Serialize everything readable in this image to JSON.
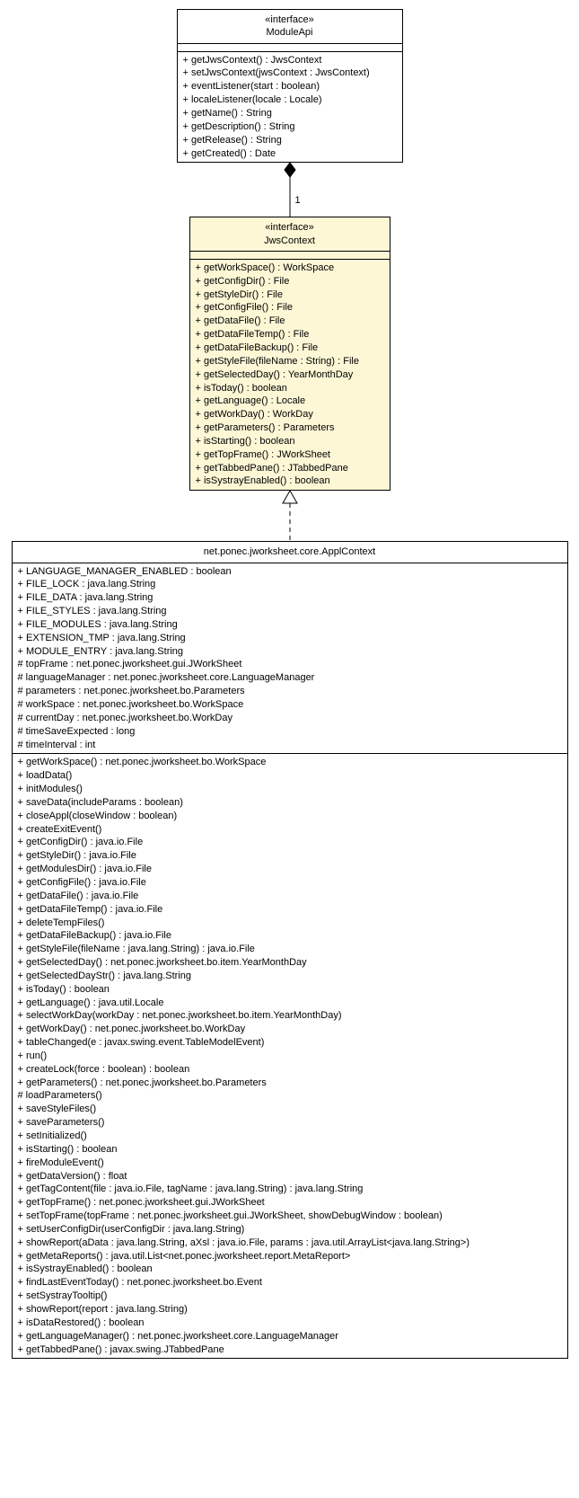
{
  "moduleApi": {
    "stereotype": "«interface»",
    "name": "ModuleApi",
    "ops": [
      "+ getJwsContext() : JwsContext",
      "+ setJwsContext(jwsContext : JwsContext)",
      "+ eventListener(start : boolean)",
      "+ localeListener(locale : Locale)",
      "+ getName() : String",
      "+ getDescription() : String",
      "+ getRelease() : String",
      "+ getCreated() : Date"
    ]
  },
  "multiplicity": "1",
  "jwsContext": {
    "stereotype": "«interface»",
    "name": "JwsContext",
    "ops": [
      "+ getWorkSpace() : WorkSpace",
      "+ getConfigDir() : File",
      "+ getStyleDir() : File",
      "+ getConfigFile() : File",
      "+ getDataFile() : File",
      "+ getDataFileTemp() : File",
      "+ getDataFileBackup() : File",
      "+ getStyleFile(fileName : String) : File",
      "+ getSelectedDay() : YearMonthDay",
      "+ isToday() : boolean",
      "+ getLanguage() : Locale",
      "+ getWorkDay() : WorkDay",
      "+ getParameters() : Parameters",
      "+ isStarting() : boolean",
      "+ getTopFrame() : JWorkSheet",
      "+ getTabbedPane() : JTabbedPane",
      "+ isSystrayEnabled() : boolean"
    ]
  },
  "applContext": {
    "name": "net.ponec.jworksheet.core.ApplContext",
    "attrs": [
      "+ LANGUAGE_MANAGER_ENABLED : boolean",
      "+ FILE_LOCK : java.lang.String",
      "+ FILE_DATA : java.lang.String",
      "+ FILE_STYLES : java.lang.String",
      "+ FILE_MODULES : java.lang.String",
      "+ EXTENSION_TMP : java.lang.String",
      "+ MODULE_ENTRY : java.lang.String",
      "# topFrame : net.ponec.jworksheet.gui.JWorkSheet",
      "# languageManager : net.ponec.jworksheet.core.LanguageManager",
      "# parameters : net.ponec.jworksheet.bo.Parameters",
      "# workSpace : net.ponec.jworksheet.bo.WorkSpace",
      "# currentDay : net.ponec.jworksheet.bo.WorkDay",
      "# timeSaveExpected : long",
      "# timeInterval : int"
    ],
    "ops": [
      "+ getWorkSpace() : net.ponec.jworksheet.bo.WorkSpace",
      "+ loadData()",
      "+ initModules()",
      "+ saveData(includeParams : boolean)",
      "+ closeAppl(closeWindow : boolean)",
      "+ createExitEvent()",
      "+ getConfigDir() : java.io.File",
      "+ getStyleDir() : java.io.File",
      "+ getModulesDir() : java.io.File",
      "+ getConfigFile() : java.io.File",
      "+ getDataFile() : java.io.File",
      "+ getDataFileTemp() : java.io.File",
      "+ deleteTempFiles()",
      "+ getDataFileBackup() : java.io.File",
      "+ getStyleFile(fileName : java.lang.String) : java.io.File",
      "+ getSelectedDay() : net.ponec.jworksheet.bo.item.YearMonthDay",
      "+ getSelectedDayStr() : java.lang.String",
      "+ isToday() : boolean",
      "+ getLanguage() : java.util.Locale",
      "+ selectWorkDay(workDay : net.ponec.jworksheet.bo.item.YearMonthDay)",
      "+ getWorkDay() : net.ponec.jworksheet.bo.WorkDay",
      "+ tableChanged(e : javax.swing.event.TableModelEvent)",
      "+ run()",
      "+ createLock(force : boolean) : boolean",
      "+ getParameters() : net.ponec.jworksheet.bo.Parameters",
      "# loadParameters()",
      "+ saveStyleFiles()",
      "+ saveParameters()",
      "+ setInitialized()",
      "+ isStarting() : boolean",
      "+ fireModuleEvent()",
      "+ getDataVersion() : float",
      "+ getTagContent(file : java.io.File, tagName : java.lang.String) : java.lang.String",
      "+ getTopFrame() : net.ponec.jworksheet.gui.JWorkSheet",
      "+ setTopFrame(topFrame : net.ponec.jworksheet.gui.JWorkSheet, showDebugWindow : boolean)",
      "+ setUserConfigDir(userConfigDir : java.lang.String)",
      "+ showReport(aData : java.lang.String, aXsl : java.io.File, params : java.util.ArrayList<java.lang.String>)",
      "+ getMetaReports() : java.util.List<net.ponec.jworksheet.report.MetaReport>",
      "+ isSystrayEnabled() : boolean",
      "+ findLastEventToday() : net.ponec.jworksheet.bo.Event",
      "+ setSystrayTooltip()",
      "+ showReport(report : java.lang.String)",
      "+ isDataRestored() : boolean",
      "+ getLanguageManager() : net.ponec.jworksheet.core.LanguageManager",
      "+ getTabbedPane() : javax.swing.JTabbedPane"
    ]
  }
}
